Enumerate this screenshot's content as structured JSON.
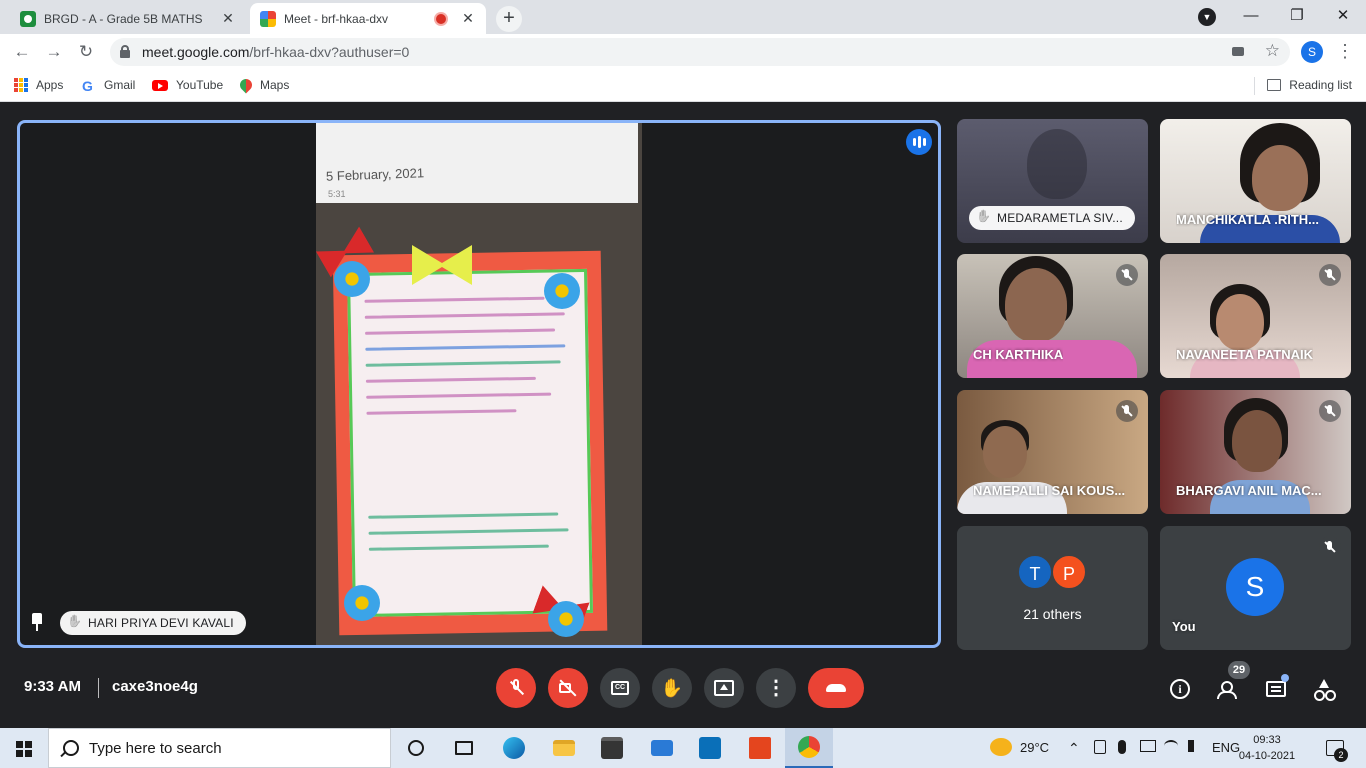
{
  "browser": {
    "tabs": [
      {
        "title": "BRGD - A - Grade 5B MATHS",
        "close": "✕"
      },
      {
        "title": "Meet - brf-hkaa-dxv",
        "close": "✕"
      }
    ],
    "new_tab": "+",
    "window_controls": {
      "minimize": "—",
      "maximize": "❐",
      "close": "✕"
    },
    "nav": {
      "back": "←",
      "forward": "→",
      "reload": "↻"
    },
    "url_host": "meet.google.com",
    "url_path": "/brf-hkaa-dxv?authuser=0",
    "profile_initial": "S",
    "menu": "⋮",
    "star": "☆"
  },
  "bookmarks": [
    {
      "label": "Apps"
    },
    {
      "label": "Gmail",
      "icon": "G"
    },
    {
      "label": "YouTube"
    },
    {
      "label": "Maps"
    }
  ],
  "reading_list": "Reading list",
  "meet": {
    "main": {
      "presenter_name": "HARI PRIYA DEVI KAVALI",
      "doc_date": "5 February, 2021",
      "doc_sub": "5:31"
    },
    "participants": [
      {
        "name": "MEDARAMETLA SIV...",
        "hand_raised": true
      },
      {
        "name": "MANCHIKATLA .RITH..."
      },
      {
        "name": "CH KARTHIKA"
      },
      {
        "name": "NAVANEETA PATNAIK"
      },
      {
        "name": "NAMEPALLI SAI KOUS..."
      },
      {
        "name": "BHARGAVI ANIL MAC..."
      }
    ],
    "others": {
      "avatars": [
        "T",
        "P"
      ],
      "label": "21 others",
      "colors": [
        "#1565c0",
        "#f4511e"
      ]
    },
    "you": {
      "label": "You",
      "initial": "S"
    },
    "time": "9:33 AM",
    "code": "caxe3noe4g",
    "controls": {
      "captions": "CC",
      "hand": "✋",
      "more": "⋮"
    },
    "people_count": "29",
    "info": "i"
  },
  "taskbar": {
    "search_placeholder": "Type here to search",
    "weather": "29°C",
    "language": "ENG",
    "time": "09:33",
    "date": "04-10-2021",
    "notifications": "2",
    "tray_chevron": "⌃"
  },
  "colors": {
    "accent": "#1a73e8",
    "end_call": "#ea4335",
    "active_border": "#8ab4f8"
  }
}
